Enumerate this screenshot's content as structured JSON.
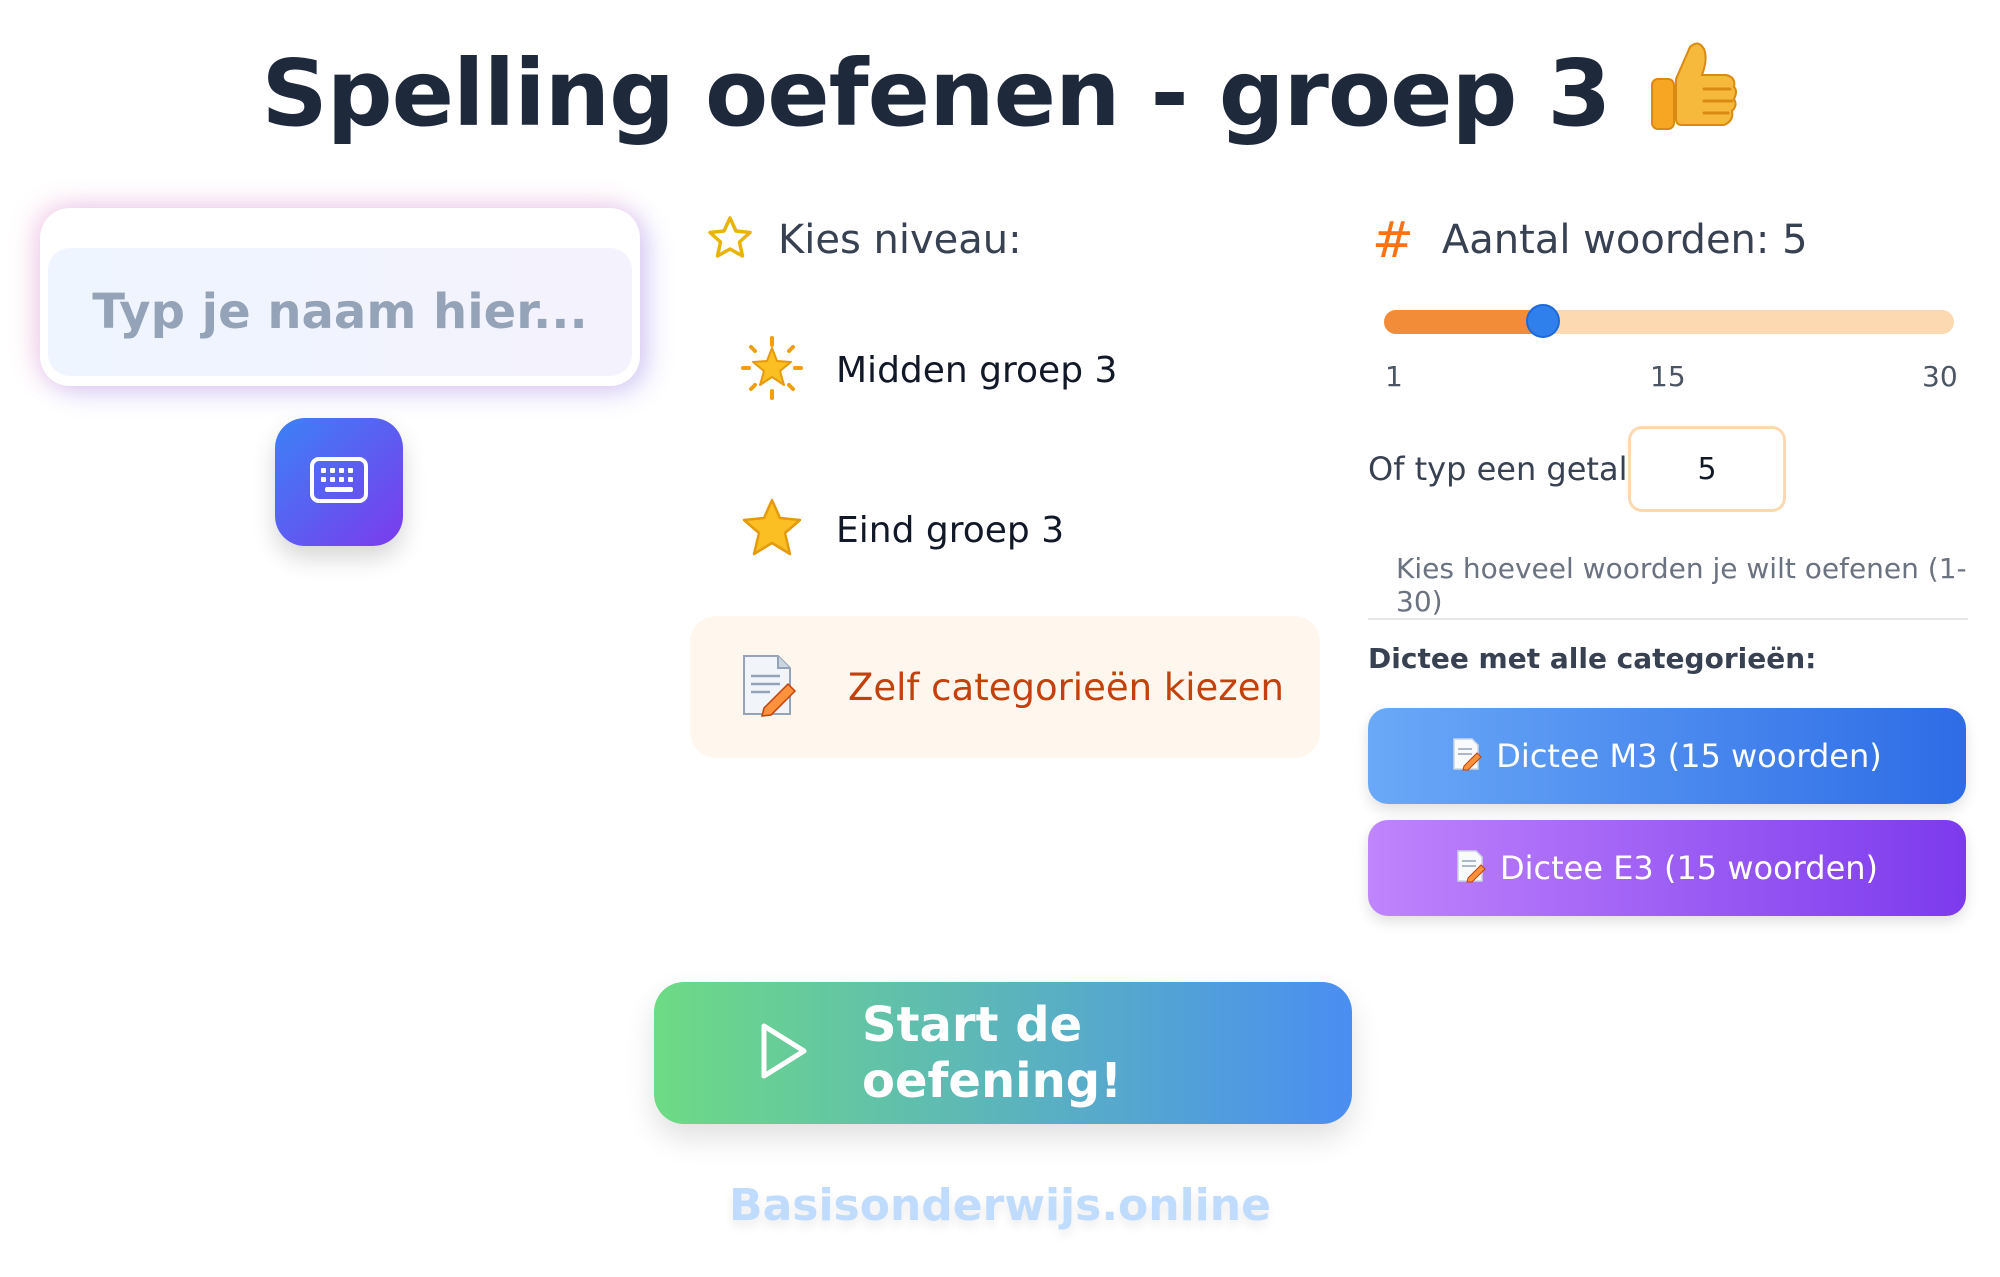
{
  "title": "Spelling oefenen - groep 3",
  "name_input": {
    "placeholder": "Typ je naam hier..."
  },
  "level": {
    "heading": "Kies niveau:",
    "options": [
      {
        "label": "Midden groep 3",
        "icon": "sparkle-star-icon"
      },
      {
        "label": "Eind groep 3",
        "icon": "star-icon"
      }
    ],
    "categories_label": "Zelf categorieën kiezen"
  },
  "word_count": {
    "heading": "Aantal woorden: 5",
    "value": 5,
    "min": 1,
    "max": 30,
    "ticks": [
      "1",
      "15",
      "30"
    ],
    "manual_label": "Of typ een getal:",
    "manual_value": "5",
    "hint": "Kies hoeveel woorden je wilt oefenen (1-30)"
  },
  "dictee": {
    "label": "Dictee met alle categorieën:",
    "buttons": [
      {
        "label": "Dictee M3 (15 woorden)"
      },
      {
        "label": "Dictee E3 (15 woorden)"
      }
    ]
  },
  "start_label": "Start de oefening!",
  "footer": "Basisonderwijs.online",
  "colors": {
    "title": "#1e293b",
    "accent_orange": "#f97316",
    "slider_thumb": "#2f80ed",
    "start_from": "#6ddb84",
    "start_to": "#4a8ef2"
  }
}
